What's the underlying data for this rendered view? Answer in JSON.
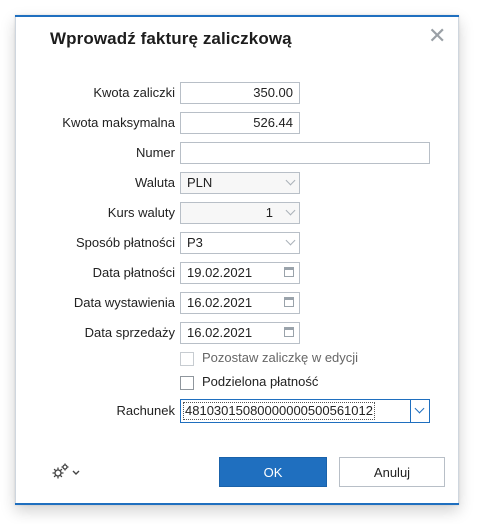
{
  "dialog": {
    "title": "Wprowadź fakturę zaliczkową",
    "close_label": "✕"
  },
  "fields": {
    "kwota_zaliczki": {
      "label": "Kwota zaliczki",
      "value": "350.00"
    },
    "kwota_maksymalna": {
      "label": "Kwota maksymalna",
      "value": "526.44"
    },
    "numer": {
      "label": "Numer",
      "value": ""
    },
    "waluta": {
      "label": "Waluta",
      "value": "PLN"
    },
    "kurs_waluty": {
      "label": "Kurs waluty",
      "value": "1"
    },
    "sposob_platnosci": {
      "label": "Sposób płatności",
      "value": "P3"
    },
    "data_platnosci": {
      "label": "Data płatności",
      "value": "19.02.2021"
    },
    "data_wystawienia": {
      "label": "Data wystawienia",
      "value": "16.02.2021"
    },
    "data_sprzedazy": {
      "label": "Data sprzedaży",
      "value": "16.02.2021"
    },
    "pozostaw": {
      "label": "Pozostaw zaliczkę w edycji",
      "checked": false,
      "enabled": false
    },
    "podzielona": {
      "label": "Podzielona płatność",
      "checked": false,
      "enabled": true
    },
    "rachunek": {
      "label": "Rachunek",
      "value": "48103015080000000500561012"
    }
  },
  "footer": {
    "settings_icon": "gear-icon",
    "ok_label": "OK",
    "cancel_label": "Anuluj"
  },
  "colors": {
    "accent": "#1f6fbf",
    "border": "#b8bfc7"
  }
}
